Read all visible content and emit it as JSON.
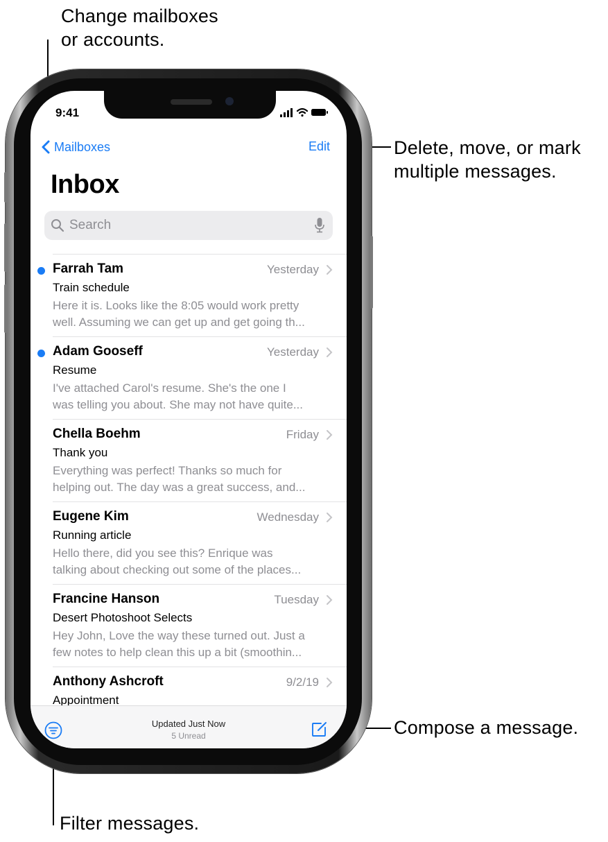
{
  "callouts": {
    "mailboxes": [
      "Change mailboxes",
      "or accounts."
    ],
    "edit": [
      "Delete, move, or mark",
      "multiple messages."
    ],
    "compose": "Compose a message.",
    "filter": "Filter messages."
  },
  "status_bar": {
    "time": "9:41"
  },
  "nav": {
    "back_label": "Mailboxes",
    "edit_label": "Edit"
  },
  "page_title": "Inbox",
  "search": {
    "placeholder": "Search"
  },
  "messages": [
    {
      "sender": "Farrah Tam",
      "date": "Yesterday",
      "subject": "Train schedule",
      "preview_1": "Here it is. Looks like the 8:05 would work pretty",
      "preview_2": "well. Assuming we can get up and get going th...",
      "unread": true
    },
    {
      "sender": "Adam Gooseff",
      "date": "Yesterday",
      "subject": "Resume",
      "preview_1": "I've attached Carol's resume. She's the one I",
      "preview_2": "was telling you about. She may not have quite...",
      "unread": true
    },
    {
      "sender": "Chella Boehm",
      "date": "Friday",
      "subject": "Thank you",
      "preview_1": "Everything was perfect! Thanks so much for",
      "preview_2": "helping out. The day was a great success, and...",
      "unread": false
    },
    {
      "sender": "Eugene Kim",
      "date": "Wednesday",
      "subject": "Running article",
      "preview_1": "Hello there, did you see this? Enrique was",
      "preview_2": "talking about checking out some of the places...",
      "unread": false
    },
    {
      "sender": "Francine Hanson",
      "date": "Tuesday",
      "subject": "Desert Photoshoot Selects",
      "preview_1": "Hey John, Love the way these turned out. Just a",
      "preview_2": "few notes to help clean this up a bit (smoothin...",
      "unread": false
    },
    {
      "sender": "Anthony Ashcroft",
      "date": "9/2/19",
      "subject": "Appointment",
      "preview_1": "",
      "preview_2": "",
      "unread": false
    }
  ],
  "toolbar": {
    "status": "Updated Just Now",
    "unread_count": "5 Unread"
  },
  "colors": {
    "accent": "#1a7cf5",
    "secondary_text": "#8e8e93"
  },
  "icons": [
    "chevron-left-icon",
    "search-icon",
    "microphone-icon",
    "chevron-right-icon",
    "filter-icon",
    "compose-icon",
    "signal-icon",
    "wifi-icon",
    "battery-icon"
  ]
}
